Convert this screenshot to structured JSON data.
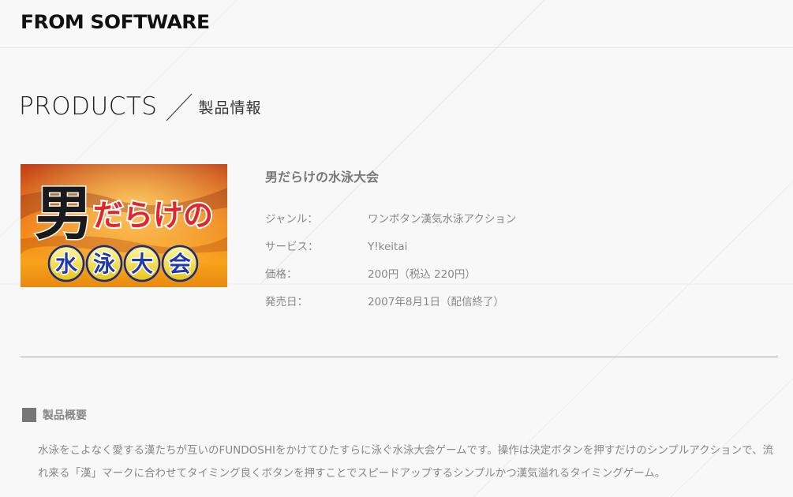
{
  "header": {
    "logo_text": "FROM SOFTWARE"
  },
  "page": {
    "heading_en": "PRODUCTS",
    "heading_ja": "製品情報"
  },
  "product": {
    "title": "男だらけの水泳大会",
    "image_text_top": "男だらけの",
    "image_text_bottom": [
      "水",
      "泳",
      "大",
      "会"
    ],
    "specs": [
      {
        "label": "ジャンル：",
        "value": "ワンボタン漢気水泳アクション"
      },
      {
        "label": "サービス：",
        "value": "Y!keitai"
      },
      {
        "label": "価格：",
        "value": "200円（税込 220円）"
      },
      {
        "label": "発売日：",
        "value": "2007年8月1日（配信終了）"
      }
    ]
  },
  "overview": {
    "label": "製品概要",
    "text": "水泳をこよなく愛する漢たちが互いのFUNDOSHIをかけてひたすらに泳ぐ水泳大会ゲームです。操作は決定ボタンを押すだけのシンプルアクションで、流れ来る「漢」マークに合わせてタイミング良くボタンを押すことでスピードアップするシンプルかつ漢気溢れるタイミングゲーム。"
  },
  "colors": {
    "background": "#f8f8f8",
    "text": "#888888",
    "heading": "#222222",
    "logo": "#111111"
  }
}
